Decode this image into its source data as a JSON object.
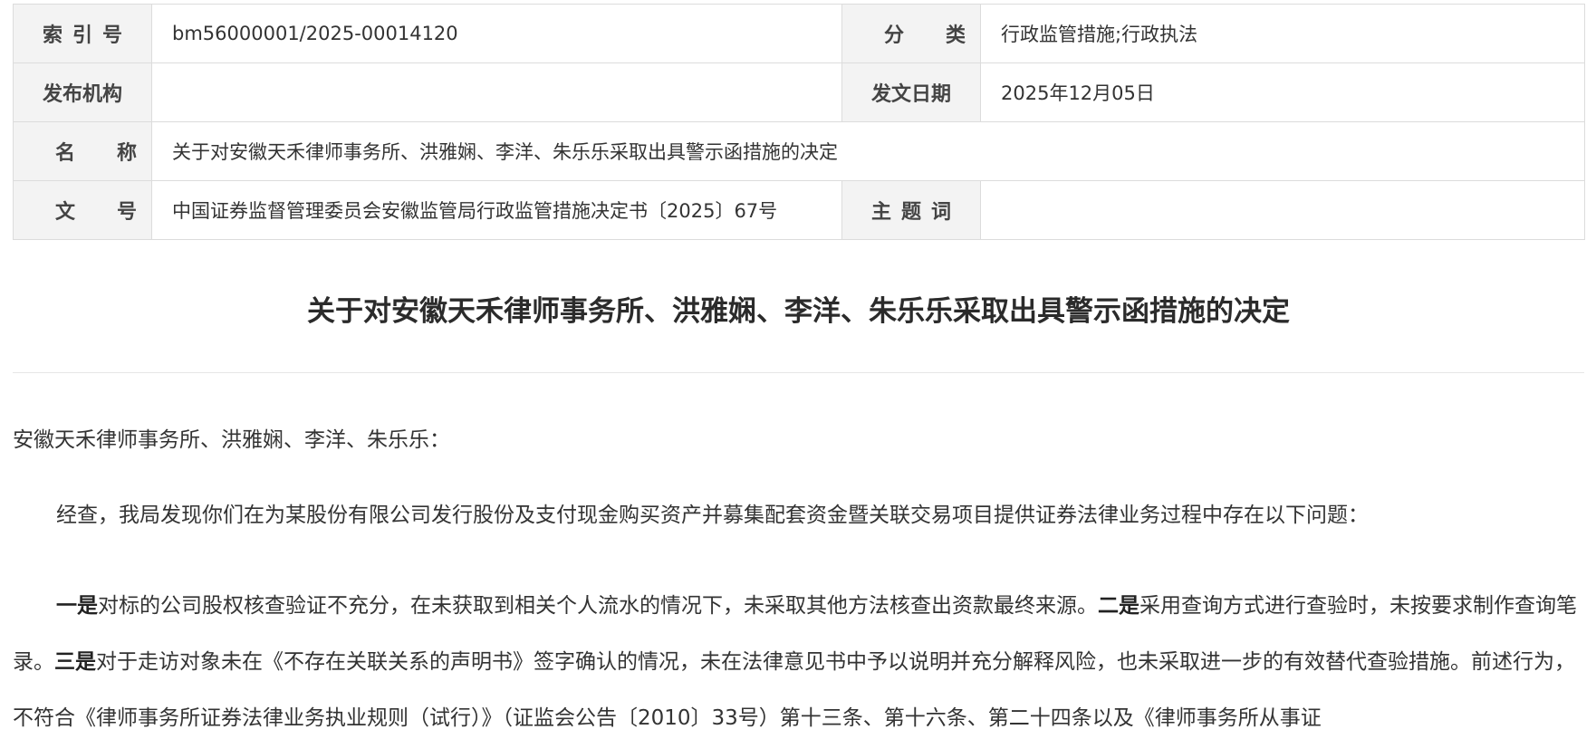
{
  "meta": {
    "index_label": "索引号",
    "index_value": "bm56000001/2025-00014120",
    "category_label": "分类",
    "category_value": "行政监管措施;行政执法",
    "issuer_label": "发布机构",
    "issuer_value": "",
    "date_label": "发文日期",
    "date_value": "2025年12月05日",
    "name_label": "名称",
    "name_value": "关于对安徽天禾律师事务所、洪雅娴、李洋、朱乐乐采取出具警示函措施的决定",
    "docno_label": "文号",
    "docno_value": "中国证券监督管理委员会安徽监管局行政监管措施决定书〔2025〕67号",
    "subject_label": "主题词",
    "subject_value": ""
  },
  "document": {
    "title": "关于对安徽天禾律师事务所、洪雅娴、李洋、朱乐乐采取出具警示函措施的决定",
    "addressee": "安徽天禾律师事务所、洪雅娴、李洋、朱乐乐：",
    "para1": "经查，我局发现你们在为某股份有限公司发行股份及支付现金购买资产并募集配套资金暨关联交易项目提供证券法律业务过程中存在以下问题：",
    "para2": {
      "lead1": "一是",
      "text1": "对标的公司股权核查验证不充分，在未获取到相关个人流水的情况下，未采取其他方法核查出资款最终来源。",
      "lead2": "二是",
      "text2": "采用查询方式进行查验时，未按要求制作查询笔录。",
      "lead3": "三是",
      "text3": "对于走访对象未在《不存在关联关系的声明书》签字确认的情况，未在法律意见书中予以说明并充分解释风险，也未采取进一步的有效替代查验措施。前述行为，不符合《律师事务所证券法律业务执业规则（试行）》（证监会公告〔2010〕33号）第十三条、第十六条、第二十四条以及《律师事务所从事证"
    }
  }
}
